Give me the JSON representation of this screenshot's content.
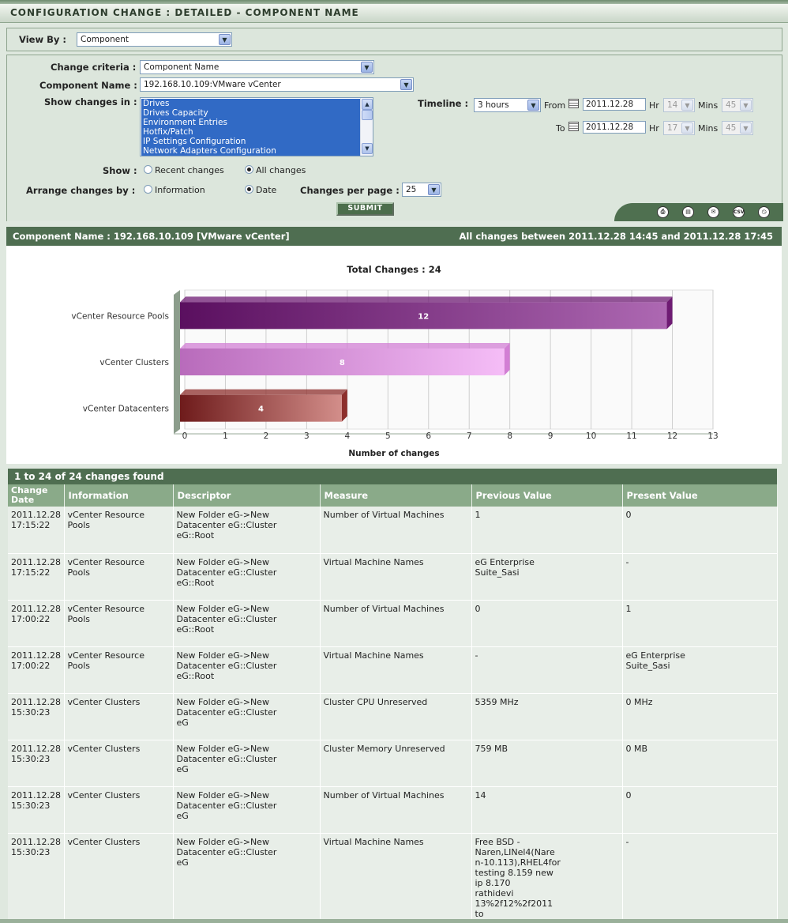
{
  "title": "CONFIGURATION CHANGE : DETAILED - COMPONENT NAME",
  "view_by": {
    "label": "View By :",
    "value": "Component"
  },
  "form": {
    "change_criteria": {
      "label": "Change criteria :",
      "value": "Component Name"
    },
    "component_name": {
      "label": "Component Name :",
      "value": "192.168.10.109:VMware vCenter"
    },
    "show_changes_in": {
      "label": "Show changes in :",
      "items": [
        "Drives",
        "Drives Capacity",
        "Environment Entries",
        "Hotfix/Patch",
        "IP Settings Configuration",
        "Network Adapters Configuration"
      ]
    },
    "timeline": {
      "label": "Timeline :",
      "value": "3 hours",
      "from_label": "From",
      "to_label": "To",
      "from_date": "2011.12.28",
      "to_date": "2011.12.28",
      "hr_label": "Hr",
      "mins_label": "Mins",
      "from_hr": "14",
      "from_min": "45",
      "to_hr": "17",
      "to_min": "45"
    },
    "show": {
      "label": "Show :",
      "options": [
        "Recent changes",
        "All changes"
      ],
      "selected": "All changes"
    },
    "arrange": {
      "label": "Arrange changes by :",
      "options": [
        "Information",
        "Date"
      ],
      "selected": "Date"
    },
    "per_page": {
      "label": "Changes per page :",
      "value": "25"
    },
    "submit_label": "SUBMIT"
  },
  "icons": [
    "print-icon",
    "pdf-icon",
    "mail-icon",
    "csv-icon",
    "timer-icon"
  ],
  "icon_texts": {
    "csv": "CSV"
  },
  "component_bar": {
    "left": "Component Name : 192.168.10.109 [VMware vCenter]",
    "right": "All changes between 2011.12.28 14:45 and 2011.12.28 17:45"
  },
  "chart_data": {
    "type": "bar",
    "orientation": "horizontal",
    "title": "Total Changes : 24",
    "xlabel": "Number of changes",
    "ylabel": "",
    "categories": [
      "vCenter Resource Pools",
      "vCenter Clusters",
      "vCenter Datacenters"
    ],
    "values": [
      12,
      8,
      4
    ],
    "xlim": [
      0,
      13
    ],
    "xticks": [
      "0",
      "1",
      "2",
      "3",
      "4",
      "5",
      "6",
      "7",
      "8",
      "9",
      "10",
      "11",
      "12",
      "13"
    ],
    "colors": [
      "#6e1b73",
      "#d27fd4",
      "#8d2f2c"
    ],
    "grid": true
  },
  "table": {
    "summary": "1 to 24 of 24 changes found",
    "headers": [
      "Change Date",
      "Information",
      "Descriptor",
      "Measure",
      "Previous Value",
      "Present Value"
    ],
    "rows": [
      [
        "2011.12.28\n17:15:22",
        "vCenter Resource\nPools",
        "New Folder eG->New\nDatacenter eG::Cluster\neG::Root",
        "Number of Virtual Machines",
        "1",
        "0"
      ],
      [
        "2011.12.28\n17:15:22",
        "vCenter Resource\nPools",
        "New Folder eG->New\nDatacenter eG::Cluster\neG::Root",
        "Virtual Machine Names",
        "eG Enterprise\nSuite_Sasi",
        "-"
      ],
      [
        "2011.12.28\n17:00:22",
        "vCenter Resource\nPools",
        "New Folder eG->New\nDatacenter eG::Cluster\neG::Root",
        "Number of Virtual Machines",
        "0",
        "1"
      ],
      [
        "2011.12.28\n17:00:22",
        "vCenter Resource\nPools",
        "New Folder eG->New\nDatacenter eG::Cluster\neG::Root",
        "Virtual Machine Names",
        "-",
        "eG Enterprise\nSuite_Sasi"
      ],
      [
        "2011.12.28\n15:30:23",
        "vCenter Clusters",
        "New Folder eG->New\nDatacenter eG::Cluster\neG",
        "Cluster CPU Unreserved",
        "5359 MHz",
        "0 MHz"
      ],
      [
        "2011.12.28\n15:30:23",
        "vCenter Clusters",
        "New Folder eG->New\nDatacenter eG::Cluster\neG",
        "Cluster Memory Unreserved",
        "759 MB",
        "0 MB"
      ],
      [
        "2011.12.28\n15:30:23",
        "vCenter Clusters",
        "New Folder eG->New\nDatacenter eG::Cluster\neG",
        "Number of Virtual Machines",
        "14",
        "0"
      ],
      [
        "2011.12.28\n15:30:23",
        "vCenter Clusters",
        "New Folder eG->New\nDatacenter eG::Cluster\neG",
        "Virtual Machine Names",
        "Free BSD -\nNaren,LINel4(Nare\nn-10.113),RHEL4for\ntesting 8.159 new\nip 8.170\nrathidevi\n13%2f12%2f2011\nto",
        "-"
      ]
    ]
  }
}
